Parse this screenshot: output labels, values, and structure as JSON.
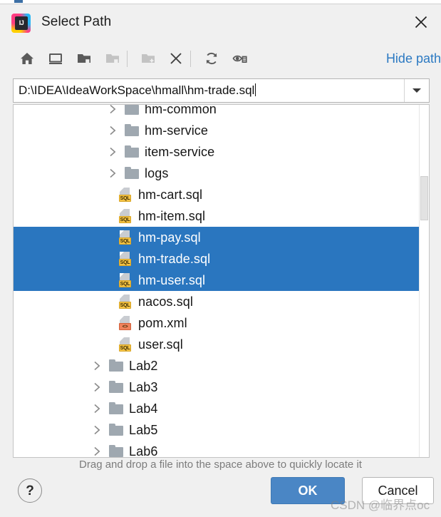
{
  "window": {
    "title": "Select Path",
    "app_icon": "intellij-idea-logo",
    "close_label": "✕"
  },
  "toolbar": {
    "buttons": [
      {
        "name": "home",
        "icon": "home-icon",
        "tooltip": "Home",
        "enabled": true
      },
      {
        "name": "desktop",
        "icon": "desktop-icon",
        "tooltip": "Desktop",
        "enabled": true
      },
      {
        "name": "project",
        "icon": "project-folder-icon",
        "tooltip": "Project Directory",
        "enabled": true
      },
      {
        "name": "module",
        "icon": "module-folder-icon",
        "tooltip": "Module Directory",
        "enabled": false
      },
      {
        "name": "new-folder",
        "icon": "new-folder-icon",
        "tooltip": "New Folder",
        "enabled": false
      },
      {
        "name": "delete",
        "icon": "delete-x-icon",
        "tooltip": "Delete",
        "enabled": true
      },
      {
        "name": "refresh",
        "icon": "refresh-icon",
        "tooltip": "Refresh",
        "enabled": true
      },
      {
        "name": "show-hidden",
        "icon": "show-hidden-files-icon",
        "tooltip": "Show Hidden Files",
        "enabled": true
      }
    ],
    "hide_path_label": "Hide path"
  },
  "path_field": {
    "value": "D:\\IDEA\\IdeaWorkSpace\\hmall\\hm-trade.sql",
    "placeholder": "",
    "dropdown_icon": "chevron-down-icon"
  },
  "file_list": {
    "rows": [
      {
        "label": "hm-common",
        "kind": "folder",
        "expandable": true,
        "indent": 1,
        "selected": false
      },
      {
        "label": "hm-service",
        "kind": "folder",
        "expandable": true,
        "indent": 1,
        "selected": false
      },
      {
        "label": "item-service",
        "kind": "folder",
        "expandable": true,
        "indent": 1,
        "selected": false
      },
      {
        "label": "logs",
        "kind": "folder",
        "expandable": true,
        "indent": 1,
        "selected": false
      },
      {
        "label": "hm-cart.sql",
        "kind": "sql",
        "expandable": false,
        "indent": 2,
        "selected": false
      },
      {
        "label": "hm-item.sql",
        "kind": "sql",
        "expandable": false,
        "indent": 2,
        "selected": false
      },
      {
        "label": "hm-pay.sql",
        "kind": "sql",
        "expandable": false,
        "indent": 2,
        "selected": true
      },
      {
        "label": "hm-trade.sql",
        "kind": "sql",
        "expandable": false,
        "indent": 2,
        "selected": true
      },
      {
        "label": "hm-user.sql",
        "kind": "sql",
        "expandable": false,
        "indent": 2,
        "selected": true
      },
      {
        "label": "nacos.sql",
        "kind": "sql",
        "expandable": false,
        "indent": 2,
        "selected": false
      },
      {
        "label": "pom.xml",
        "kind": "xml",
        "expandable": false,
        "indent": 2,
        "selected": false
      },
      {
        "label": "user.sql",
        "kind": "sql",
        "expandable": false,
        "indent": 2,
        "selected": false
      },
      {
        "label": "Lab2",
        "kind": "folder",
        "expandable": true,
        "indent": 0,
        "selected": false
      },
      {
        "label": "Lab3",
        "kind": "folder",
        "expandable": true,
        "indent": 0,
        "selected": false
      },
      {
        "label": "Lab4",
        "kind": "folder",
        "expandable": true,
        "indent": 0,
        "selected": false
      },
      {
        "label": "Lab5",
        "kind": "folder",
        "expandable": true,
        "indent": 0,
        "selected": false
      },
      {
        "label": "Lab6",
        "kind": "folder",
        "expandable": true,
        "indent": 0,
        "selected": false
      }
    ],
    "badge_text": {
      "sql": "SQL",
      "xml": "<>"
    }
  },
  "hint": "Drag and drop a file into the space above to quickly locate it",
  "footer": {
    "help_label": "?",
    "ok_label": "OK",
    "cancel_label": "Cancel"
  },
  "watermark": "CSDN @临界点oc",
  "colors": {
    "selection_blue": "#2a76bf",
    "link_blue": "#2b79c2",
    "ok_button_blue": "#4a86c5",
    "dialog_bg": "#f0f0f0",
    "list_bg": "#ffffff",
    "folder_gray": "#9fa8b0",
    "sql_badge": "#f5c344",
    "xml_badge": "#f0825b"
  }
}
